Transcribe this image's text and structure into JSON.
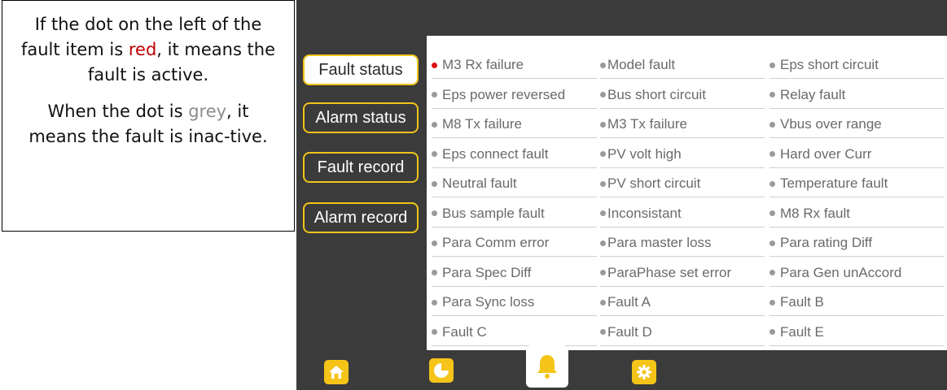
{
  "callout": {
    "p1_pre": "If the dot on the left of the fault item is ",
    "p1_red": "red",
    "p1_post": ", it means the fault is active.",
    "p2_pre": "When the dot is ",
    "p2_grey": "grey",
    "p2_post": ", it means the fault is inac-tive.",
    "red_color": "#c00000",
    "grey_color": "#8c8c8c"
  },
  "sidebar": {
    "items": [
      {
        "label": "Fault status"
      },
      {
        "label": "Alarm status"
      },
      {
        "label": "Fault record"
      },
      {
        "label": "Alarm record"
      }
    ],
    "active_index": 0,
    "accent": "#f0c419"
  },
  "faults": [
    {
      "label": "M3 Rx failure",
      "active": true
    },
    {
      "label": "Model fault",
      "active": false
    },
    {
      "label": "Eps short circuit",
      "active": false
    },
    {
      "label": "Eps power reversed",
      "active": false
    },
    {
      "label": "Bus short circuit",
      "active": false
    },
    {
      "label": "Relay fault",
      "active": false
    },
    {
      "label": "M8 Tx failure",
      "active": false
    },
    {
      "label": "M3 Tx failure",
      "active": false
    },
    {
      "label": "Vbus over range",
      "active": false
    },
    {
      "label": "Eps connect fault",
      "active": false
    },
    {
      "label": "PV volt high",
      "active": false
    },
    {
      "label": "Hard over Curr",
      "active": false
    },
    {
      "label": "Neutral fault",
      "active": false
    },
    {
      "label": "PV short circuit",
      "active": false
    },
    {
      "label": "Temperature fault",
      "active": false
    },
    {
      "label": "Bus sample fault",
      "active": false
    },
    {
      "label": "Inconsistant",
      "active": false
    },
    {
      "label": "M8 Rx fault",
      "active": false
    },
    {
      "label": "Para Comm error",
      "active": false
    },
    {
      "label": "Para master loss",
      "active": false
    },
    {
      "label": "Para rating Diff",
      "active": false
    },
    {
      "label": "Para Spec Diff",
      "active": false
    },
    {
      "label": "ParaPhase set error",
      "active": false
    },
    {
      "label": "Para Gen unAccord",
      "active": false
    },
    {
      "label": "Para Sync loss",
      "active": false
    },
    {
      "label": "Fault A",
      "active": false
    },
    {
      "label": "Fault B",
      "active": false
    },
    {
      "label": "Fault C",
      "active": false
    },
    {
      "label": "Fault D",
      "active": false
    },
    {
      "label": "Fault E",
      "active": false
    }
  ],
  "colors": {
    "screen_bg": "#3b3b3b",
    "active_dot": "#e01010",
    "inactive_dot": "#9a9a9a",
    "nav_icon": "#f5c418"
  },
  "nav": [
    {
      "icon": "home-icon",
      "active": false
    },
    {
      "icon": "pie-chart-icon",
      "active": false
    },
    {
      "icon": "bell-icon",
      "active": true
    },
    {
      "icon": "gear-icon",
      "active": false
    }
  ]
}
